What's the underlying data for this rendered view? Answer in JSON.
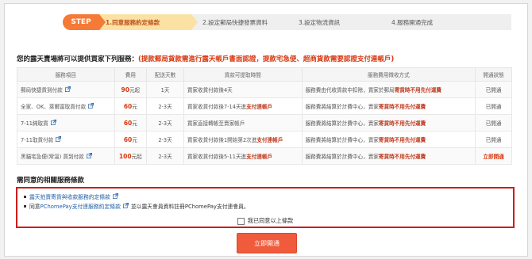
{
  "steps": {
    "badge": "STEP",
    "items": [
      {
        "label": "1.同意服務約定條款",
        "active": true
      },
      {
        "label": "2.設定郵局快捷發票資料",
        "active": false
      },
      {
        "label": "3.設定物流資訊",
        "active": false
      },
      {
        "label": "4.服務開通完成",
        "active": false
      }
    ]
  },
  "heading": {
    "main": "您的露天賣場將可以提供買家下列服務：",
    "note": "(提款郵局貨款需進行露天帳戶書面認證，提款宅急便、超商貨款需要認證支付連帳戶)"
  },
  "table": {
    "headers": [
      "服務項目",
      "費用",
      "配送天數",
      "貨款可提取時間",
      "服務費用徵收方式",
      "開通狀態"
    ],
    "rows": [
      {
        "name": "郵局快捷貨到付款",
        "fee": "90",
        "unit": "元起",
        "days": "1天",
        "withdraw": [
          {
            "t": "買家收貨付款後4天",
            "red": false
          }
        ],
        "method": [
          {
            "t": "服務費由代收貨款中扣除，買家於郵局",
            "red": false
          },
          {
            "t": "寄貨時不用先付運費",
            "red": true
          }
        ],
        "status": "已開通",
        "status_now": false
      },
      {
        "name": "全家、OK、萊爾富取貨付款",
        "fee": "60",
        "unit": "元",
        "days": "2-3天",
        "withdraw": [
          {
            "t": "買家收貨付款後7-14天進",
            "red": false
          },
          {
            "t": "支付連帳戶",
            "red": true
          }
        ],
        "method": [
          {
            "t": "服務費將結算於計費中心，賣家",
            "red": false
          },
          {
            "t": "寄貨時不用先付運費",
            "red": true
          }
        ],
        "status": "已開通",
        "status_now": false
      },
      {
        "name": "7-11純取貨",
        "fee": "60",
        "unit": "元",
        "days": "2-3天",
        "withdraw": [
          {
            "t": "買家直接轉帳至賣家帳戶",
            "red": false
          }
        ],
        "method": [
          {
            "t": "服務費將結算於計費中心，賣家",
            "red": false
          },
          {
            "t": "寄貨時不用先付運費",
            "red": true
          }
        ],
        "status": "已開通",
        "status_now": false
      },
      {
        "name": "7-11取貨付款",
        "fee": "60",
        "unit": "元",
        "days": "2-3天",
        "withdraw": [
          {
            "t": "買家收貨付款後1開始第2次進",
            "red": false
          },
          {
            "t": "支付連帳戶",
            "red": true
          }
        ],
        "method": [
          {
            "t": "服務費將結算於計費中心，賣家",
            "red": false
          },
          {
            "t": "寄貨時不用先付運費",
            "red": true
          }
        ],
        "status": "已開通",
        "status_now": false
      },
      {
        "name": "黑貓宅急便(常溫) 貨到付款",
        "fee": "100",
        "unit": "元起",
        "days": "2-3天",
        "withdraw": [
          {
            "t": "買家收貨付款後5-11天進",
            "red": false
          },
          {
            "t": "支付連帳戶",
            "red": true
          }
        ],
        "method": [
          {
            "t": "服務費將結算於計費中心，賣家",
            "red": false
          },
          {
            "t": "寄貨時不用先付運費",
            "red": true
          }
        ],
        "status": "立即開通",
        "status_now": true
      }
    ]
  },
  "terms": {
    "title": "需同意的相關服務條款",
    "line1_link": "露天拍賣寄貨與收款服務約定條款",
    "line2_prefix": "同意",
    "line2_link": "PChomePay支付連服務約定條款",
    "line2_suffix": "並以露天會員資料註冊PChomePay支付連會員。",
    "agree_label": "我已同意以上條款"
  },
  "submit_label": "立即開通",
  "colors": {
    "accent": "#f47a36",
    "red": "#d8360e",
    "link": "#1f5fa8",
    "border_alert": "#d11b1b"
  }
}
